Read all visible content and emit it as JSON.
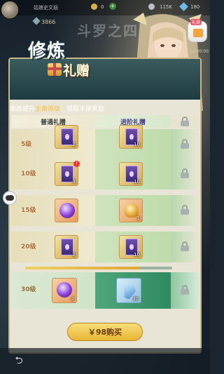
{
  "hud": {
    "player_name": "姑娘史文丽",
    "resource_gold": "0",
    "resource_silver": "115K",
    "resource_gems": "180",
    "power": "3866",
    "bg_title": "斗罗之四"
  },
  "side": {
    "gift_tag": "礼券",
    "side_label": "12:00:00"
  },
  "title": {
    "main": "修炼",
    "sub": "礼赠"
  },
  "subtitle": {
    "prefix": "修炼提升",
    "highlight": "主角等级",
    "suffix": "，领取丰厚奖励"
  },
  "columns": {
    "normal": "普通礼赠",
    "advanced": "进阶礼赠"
  },
  "rows": [
    {
      "level": "5级",
      "normal": {
        "icon": "card-icon",
        "count": "2"
      },
      "advanced": {
        "icon": "card-icon",
        "count": "10"
      }
    },
    {
      "level": "10级",
      "normal": {
        "icon": "card-icon",
        "count": "3",
        "badge": "!"
      },
      "advanced": {
        "icon": "card-icon",
        "count": "10"
      }
    },
    {
      "level": "15级",
      "normal": {
        "icon": "purple-orb-icon",
        "count": ""
      },
      "advanced": {
        "icon": "golden-bell-icon",
        "count": "1"
      }
    },
    {
      "level": "20级",
      "normal": {
        "icon": "card-icon",
        "count": "2"
      },
      "advanced": {
        "icon": "card-icon",
        "count": "10"
      }
    },
    {
      "level": "30级",
      "normal": {
        "icon": "purple-orb-icon",
        "count": "2"
      },
      "advanced": {
        "icon": "crystal-icon",
        "count": "30"
      }
    }
  ],
  "progress": {
    "value": 0.78
  },
  "buy_button": "￥98购买",
  "colors": {
    "accent_gold": "#e9b534",
    "panel_bg": "#e9e5d6",
    "advanced_column": "#bfdbaa",
    "highlight_text": "#f4c34a"
  }
}
